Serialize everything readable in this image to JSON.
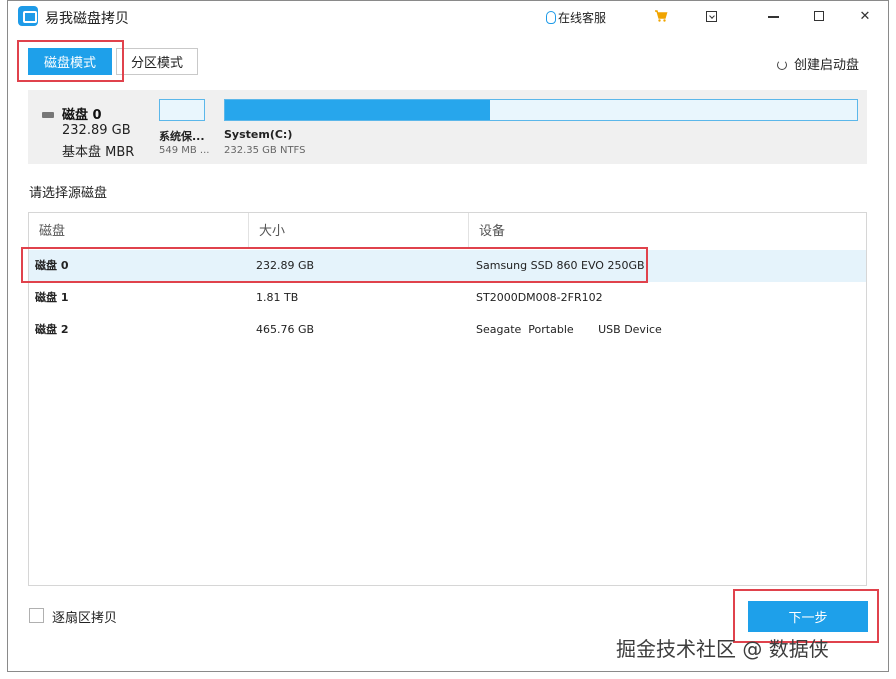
{
  "app": {
    "title": "易我磁盘拷贝"
  },
  "titlebar": {
    "support_label": "在线客服"
  },
  "tabs": {
    "disk_mode": "磁盘模式",
    "partition_mode": "分区模式"
  },
  "bootdisk_label": "创建启动盘",
  "disk_map": {
    "name": "磁盘 0",
    "size": "232.89 GB",
    "type": "基本盘 MBR",
    "partitions": [
      {
        "label": "系统保...",
        "info": "549 MB ..."
      },
      {
        "label": "System(C:)",
        "info": "232.35 GB NTFS",
        "used_fraction": 0.42
      }
    ]
  },
  "select_label": "请选择源磁盘",
  "list": {
    "columns": [
      "磁盘",
      "大小",
      "设备"
    ],
    "rows": [
      {
        "name": "磁盘 0",
        "size": "232.89 GB",
        "device": "Samsung SSD 860 EVO 250GB"
      },
      {
        "name": "磁盘 1",
        "size": "1.81 TB",
        "device": "ST2000DM008-2FR102"
      },
      {
        "name": "磁盘 2",
        "size": "465.76 GB",
        "device": "Seagate  Portable       USB Device"
      }
    ]
  },
  "footer": {
    "sector_copy_label": "逐扇区拷贝",
    "next_button": "下一步"
  },
  "watermark": "掘金技术社区 @ 数据侠",
  "colors": {
    "accent": "#1ea0ea",
    "highlight_box": "#e0424c",
    "row_selected": "#e5f3fb"
  }
}
